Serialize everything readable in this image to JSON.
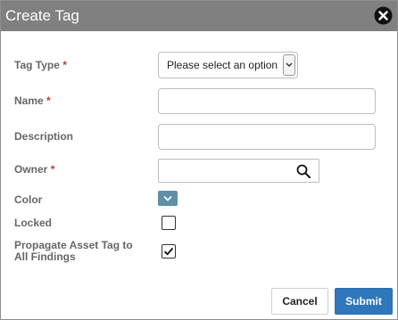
{
  "dialog": {
    "title": "Create Tag",
    "close_icon": "close-circle-icon"
  },
  "form": {
    "tag_type": {
      "label": "Tag Type",
      "required_mark": "*",
      "value": "Please select an option"
    },
    "name": {
      "label": "Name",
      "required_mark": "*",
      "value": ""
    },
    "description": {
      "label": "Description",
      "value": ""
    },
    "owner": {
      "label": "Owner",
      "required_mark": "*",
      "value": "",
      "icon": "search-icon"
    },
    "color": {
      "label": "Color",
      "value_color": "#5e8fa5",
      "icon": "chevron-down-icon"
    },
    "locked": {
      "label": "Locked",
      "checked": false
    },
    "propagate": {
      "label": "Propagate Asset Tag to All Findings",
      "checked": true
    }
  },
  "footer": {
    "cancel_label": "Cancel",
    "submit_label": "Submit"
  },
  "colors": {
    "titlebar": "#808080",
    "required": "#c0392b",
    "submit": "#2f76bb"
  }
}
